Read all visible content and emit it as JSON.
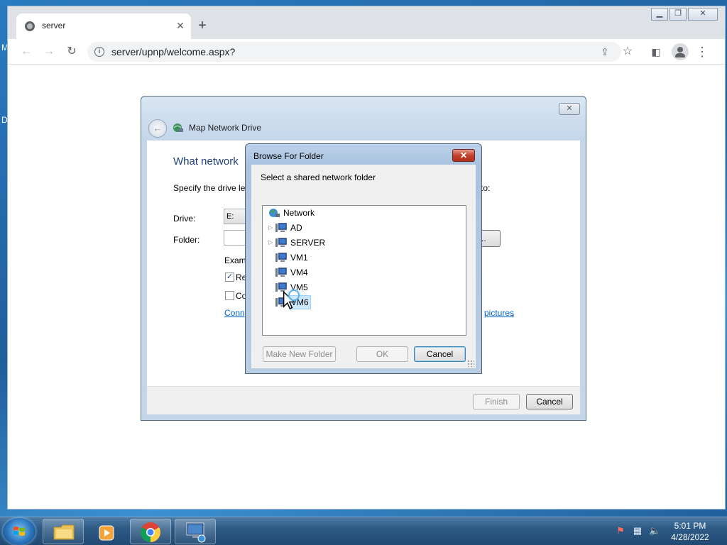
{
  "browser": {
    "tab_title": "server",
    "tab_close": "✕",
    "new_tab": "+",
    "url": "server/upnp/welcome.aspx?"
  },
  "desktop": {
    "partial_labels": [
      "M",
      "D"
    ]
  },
  "wizard": {
    "title": "Map Network Drive",
    "heading": "What network",
    "instruction_start": "Specify the drive let",
    "instruction_end": "to:",
    "drive_label": "Drive:",
    "drive_value": "E:",
    "folder_label": "Folder:",
    "browse_label": "..",
    "example_text": "Exam",
    "reconnect_text": "Re",
    "connect_text": "Co",
    "link_start": "Conn",
    "link_end": "pictures",
    "link_period": ".",
    "finish_label": "Finish",
    "cancel_label": "Cancel"
  },
  "browse_dialog": {
    "title": "Browse For Folder",
    "description": "Select a shared network folder",
    "tree": {
      "root": "Network",
      "items": [
        {
          "label": "AD",
          "expandable": true
        },
        {
          "label": "SERVER",
          "expandable": true
        },
        {
          "label": "VM1",
          "expandable": false
        },
        {
          "label": "VM4",
          "expandable": false
        },
        {
          "label": "VM5",
          "expandable": false
        },
        {
          "label": "VM6",
          "expandable": false,
          "selected": true
        }
      ]
    },
    "make_new_folder_label": "Make New Folder",
    "ok_label": "OK",
    "cancel_label": "Cancel"
  },
  "taskbar": {
    "time": "5:01 PM",
    "date": "4/28/2022",
    "pinned": [
      "explorer",
      "media-player",
      "chrome",
      "network-computer"
    ]
  }
}
